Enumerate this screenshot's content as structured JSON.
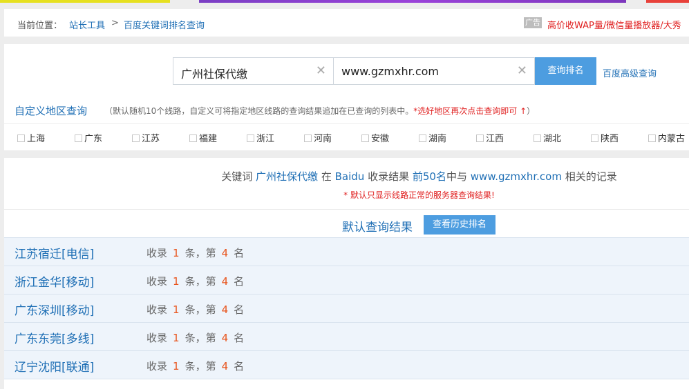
{
  "breadcrumb": {
    "here": "当前位置：",
    "items": [
      "站长工具",
      "百度关键词排名查询"
    ],
    "sep": ">"
  },
  "ad": {
    "tag": "广告",
    "text": "高价收WAP量/微信量播放器/大秀"
  },
  "search": {
    "keyword": "广州社保代缴",
    "domain": "www.gzmxhr.com",
    "clear_icon": "✕",
    "query_button": "查询排名",
    "advanced_link": "百度高级查询"
  },
  "custom": {
    "title": "自定义地区查询",
    "note_prefix": "（默认随机10个线路，自定义可将指定地区线路的查询结果追加在已查询的列表中。",
    "note_red": "*选好地区再次点击查询即可 ↑",
    "note_suffix": "）"
  },
  "regions": [
    "上海",
    "广东",
    "江苏",
    "福建",
    "浙江",
    "河南",
    "安徽",
    "湖南",
    "江西",
    "湖北",
    "陕西",
    "内蒙古"
  ],
  "summary": {
    "part1": "关键词",
    "keyword": "广州社保代缴",
    "part2": "在",
    "engine": "Baidu",
    "part3": "收录结果",
    "range": "前50名",
    "part4": "中与",
    "domain": "www.gzmxhr.com",
    "part5": "相关的记录",
    "note": "* 默认只显示线路正常的服务器查询结果!"
  },
  "default_results": {
    "title": "默认查询结果",
    "history_button": "查看历史排名"
  },
  "rows": [
    {
      "location": "江苏宿迁[电信]",
      "t1": "收录",
      "count": "1",
      "t2": "条，第",
      "rank": "4",
      "t3": "名"
    },
    {
      "location": "浙江金华[移动]",
      "t1": "收录",
      "count": "1",
      "t2": "条，第",
      "rank": "4",
      "t3": "名"
    },
    {
      "location": "广东深圳[移动]",
      "t1": "收录",
      "count": "1",
      "t2": "条，第",
      "rank": "4",
      "t3": "名"
    },
    {
      "location": "广东东莞[多线]",
      "t1": "收录",
      "count": "1",
      "t2": "条，第",
      "rank": "4",
      "t3": "名"
    },
    {
      "location": "辽宁沈阳[联通]",
      "t1": "收录",
      "count": "1",
      "t2": "条，第",
      "rank": "4",
      "t3": "名"
    }
  ]
}
